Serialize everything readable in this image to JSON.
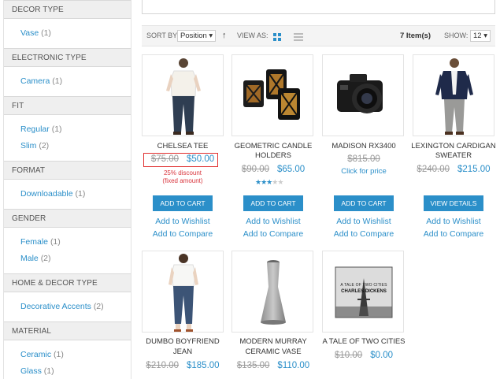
{
  "sidebar": {
    "groups": [
      {
        "title": "DECOR TYPE",
        "options": [
          {
            "label": "Vase",
            "count": "(1)"
          }
        ]
      },
      {
        "title": "ELECTRONIC TYPE",
        "options": [
          {
            "label": "Camera",
            "count": "(1)"
          }
        ]
      },
      {
        "title": "FIT",
        "options": [
          {
            "label": "Regular",
            "count": "(1)"
          },
          {
            "label": "Slim",
            "count": "(2)"
          }
        ]
      },
      {
        "title": "FORMAT",
        "options": [
          {
            "label": "Downloadable",
            "count": "(1)"
          }
        ]
      },
      {
        "title": "GENDER",
        "options": [
          {
            "label": "Female",
            "count": "(1)"
          },
          {
            "label": "Male",
            "count": "(2)"
          }
        ]
      },
      {
        "title": "HOME & DECOR TYPE",
        "options": [
          {
            "label": "Decorative Accents",
            "count": "(2)"
          }
        ]
      },
      {
        "title": "MATERIAL",
        "options": [
          {
            "label": "Ceramic",
            "count": "(1)"
          },
          {
            "label": "Glass",
            "count": "(1)"
          }
        ]
      }
    ]
  },
  "toolbar": {
    "sort_label": "SORT BY:",
    "sort_value": "Position ▾",
    "sort_dir_icon": "↑",
    "view_label": "VIEW AS:",
    "items_count": "7 Item(s)",
    "show_label": "SHOW:",
    "show_value": "12 ▾"
  },
  "products": [
    {
      "name": "CHELSEA TEE",
      "old_price": "$75.00",
      "price": "$50.00",
      "discount_note_1": "25% discount",
      "discount_note_2": "(fixed amount)",
      "button": "ADD TO CART",
      "wishlist": "Add to Wishlist",
      "compare": "Add to Compare"
    },
    {
      "name_line1": "GEOMETRIC CANDLE",
      "name_line2": "HOLDERS",
      "old_price": "$90.00",
      "price": "$65.00",
      "rating": 3,
      "rating_max": 5,
      "button": "ADD TO CART",
      "wishlist": "Add to Wishlist",
      "compare": "Add to Compare"
    },
    {
      "name": "MADISON RX3400",
      "old_price": "$815.00",
      "click_for_price": "Click for price",
      "button": "ADD TO CART",
      "wishlist": "Add to Wishlist",
      "compare": "Add to Compare"
    },
    {
      "name_line1": "LEXINGTON CARDIGAN",
      "name_line2": "SWEATER",
      "old_price": "$240.00",
      "price": "$215.00",
      "button": "VIEW DETAILS",
      "wishlist": "Add to Wishlist",
      "compare": "Add to Compare"
    },
    {
      "name_line1": "DUMBO BOYFRIEND",
      "name_line2": "JEAN",
      "old_price": "$210.00",
      "price": "$185.00"
    },
    {
      "name_line1": "MODERN MURRAY",
      "name_line2": "CERAMIC VASE",
      "old_price": "$135.00",
      "price": "$110.00"
    },
    {
      "name": "A TALE OF TWO CITIES",
      "old_price": "$10.00",
      "price": "$0.00",
      "book_cover_text_1": "A TALE OF TWO CITIES",
      "book_cover_text_2": "CHARLES DICKENS"
    }
  ],
  "colors": {
    "accent": "#2b8fc9",
    "sale_note": "#d9363e",
    "highlight": "#e03030"
  }
}
